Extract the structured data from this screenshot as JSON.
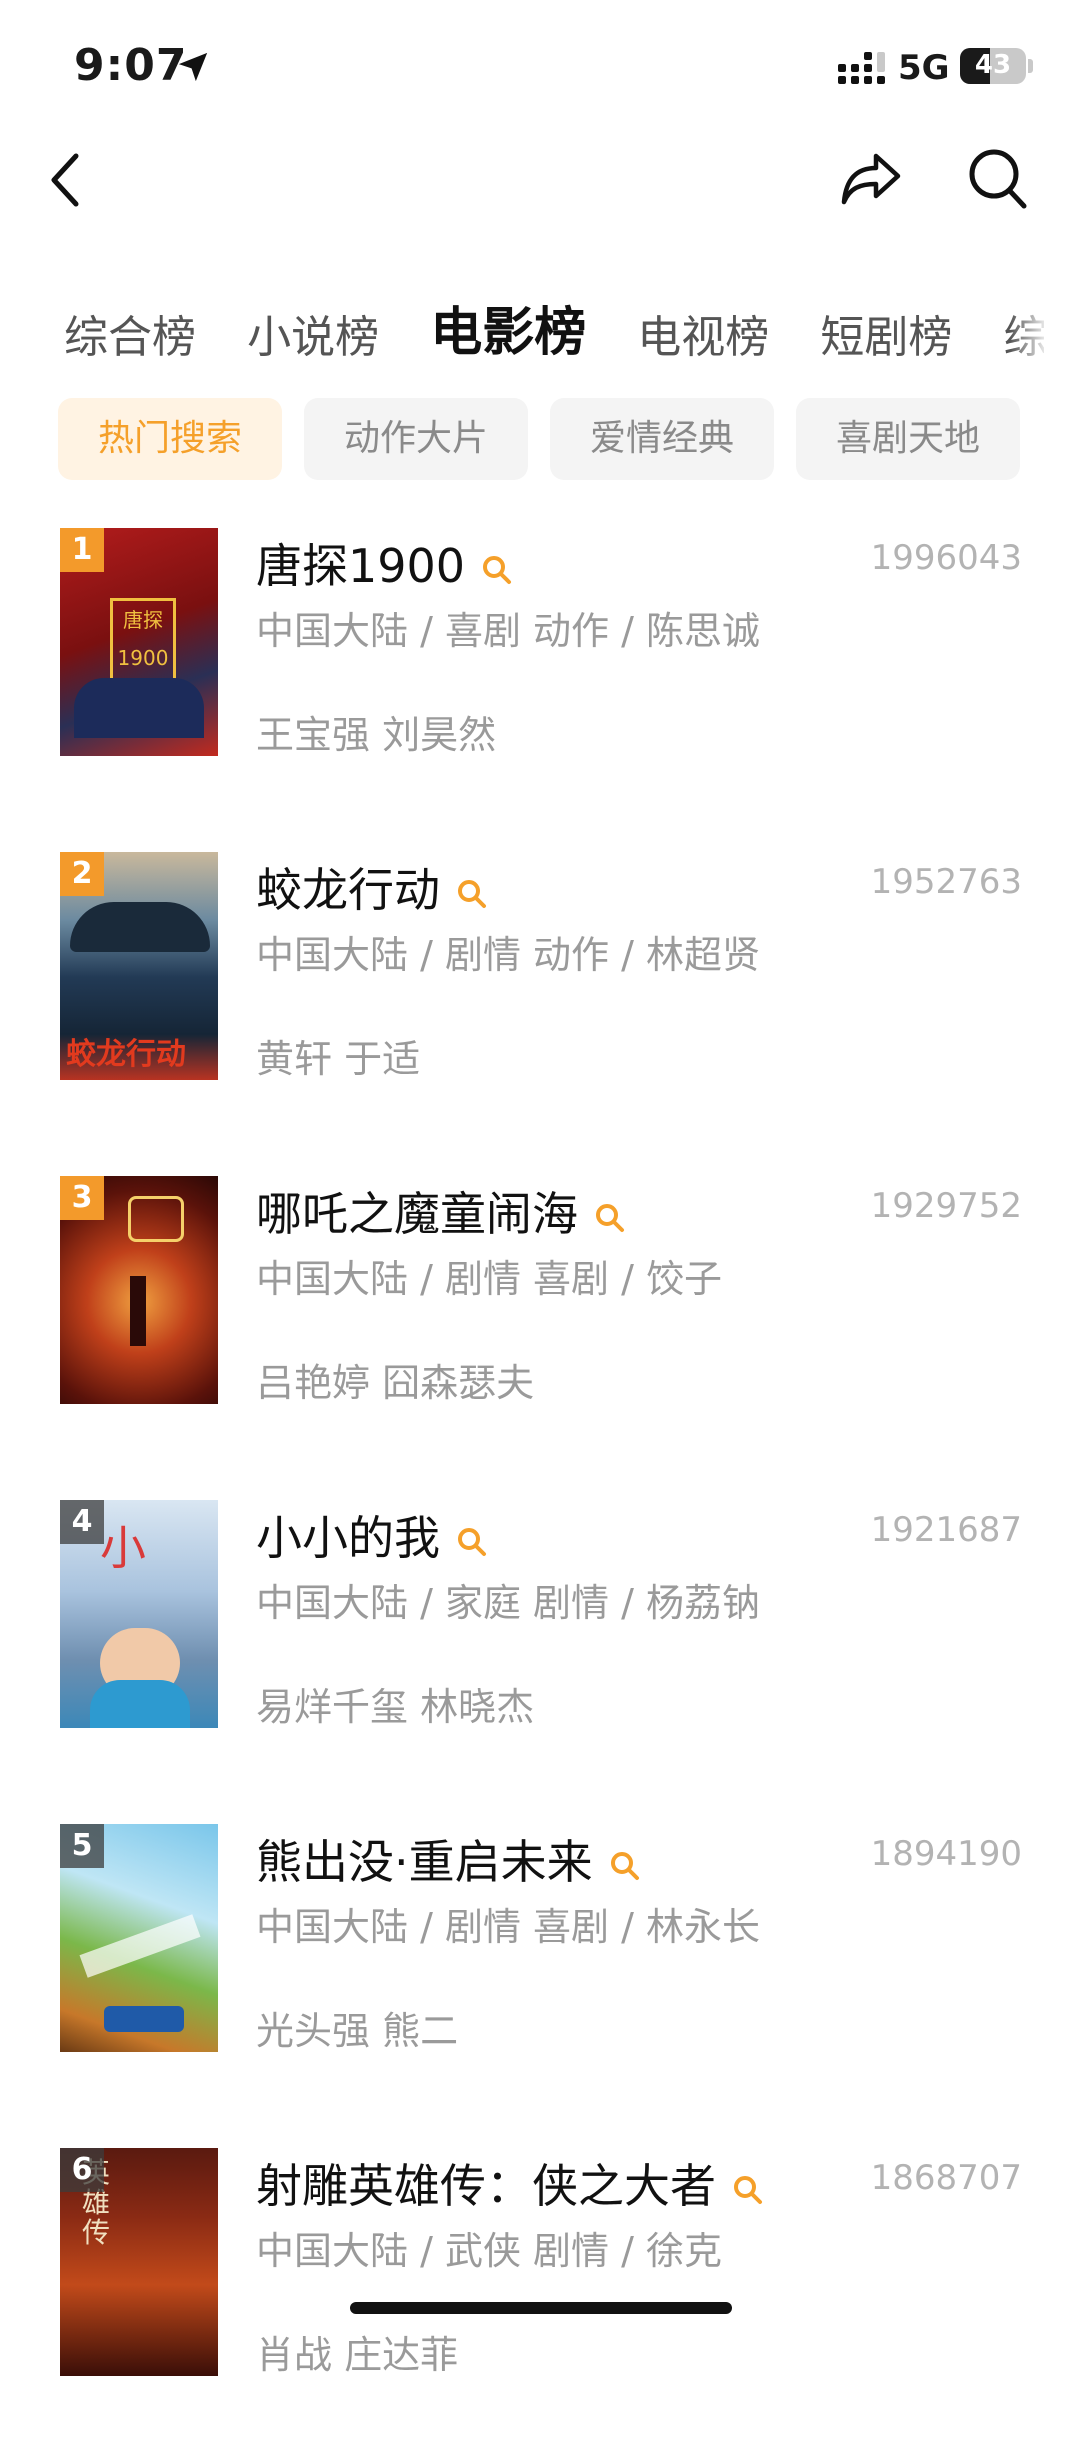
{
  "status_bar": {
    "time": "9:07",
    "network": "5G",
    "battery": "43"
  },
  "tabs": [
    {
      "label": "综合榜"
    },
    {
      "label": "小说榜"
    },
    {
      "label": "电影榜"
    },
    {
      "label": "电视榜"
    },
    {
      "label": "短剧榜"
    },
    {
      "label": "综"
    }
  ],
  "active_tab": "电影榜",
  "chips": [
    {
      "label": "热门搜索"
    },
    {
      "label": "动作大片"
    },
    {
      "label": "爱情经典"
    },
    {
      "label": "喜剧天地"
    }
  ],
  "active_chip": "热门搜索",
  "movies": [
    {
      "rank": "1",
      "title": "唐探1900",
      "count": "1996043",
      "meta": "中国大陆 / 喜剧 动作 / 陈思诚",
      "cast": "王宝强 刘昊然"
    },
    {
      "rank": "2",
      "title": "蛟龙行动",
      "count": "1952763",
      "meta": "中国大陆 / 剧情 动作 / 林超贤",
      "cast": "黄轩 于适"
    },
    {
      "rank": "3",
      "title": "哪吒之魔童闹海",
      "count": "1929752",
      "meta": "中国大陆 / 剧情 喜剧 / 饺子",
      "cast": "吕艳婷 囧森瑟夫"
    },
    {
      "rank": "4",
      "title": "小小的我",
      "count": "1921687",
      "meta": "中国大陆 / 家庭 剧情 / 杨荔钠",
      "cast": "易烊千玺 林晓杰"
    },
    {
      "rank": "5",
      "title": "熊出没·重启未来",
      "count": "1894190",
      "meta": "中国大陆 / 剧情 喜剧 / 林永长",
      "cast": "光头强 熊二"
    },
    {
      "rank": "6",
      "title": "射雕英雄传：侠之大者",
      "count": "1868707",
      "meta": "中国大陆 / 武侠 剧情 / 徐克",
      "cast": "肖战 庄达菲"
    }
  ],
  "colors": {
    "accent": "#f5a02a",
    "rank_top": "#f39a2b",
    "muted": "#9a9a9a"
  }
}
